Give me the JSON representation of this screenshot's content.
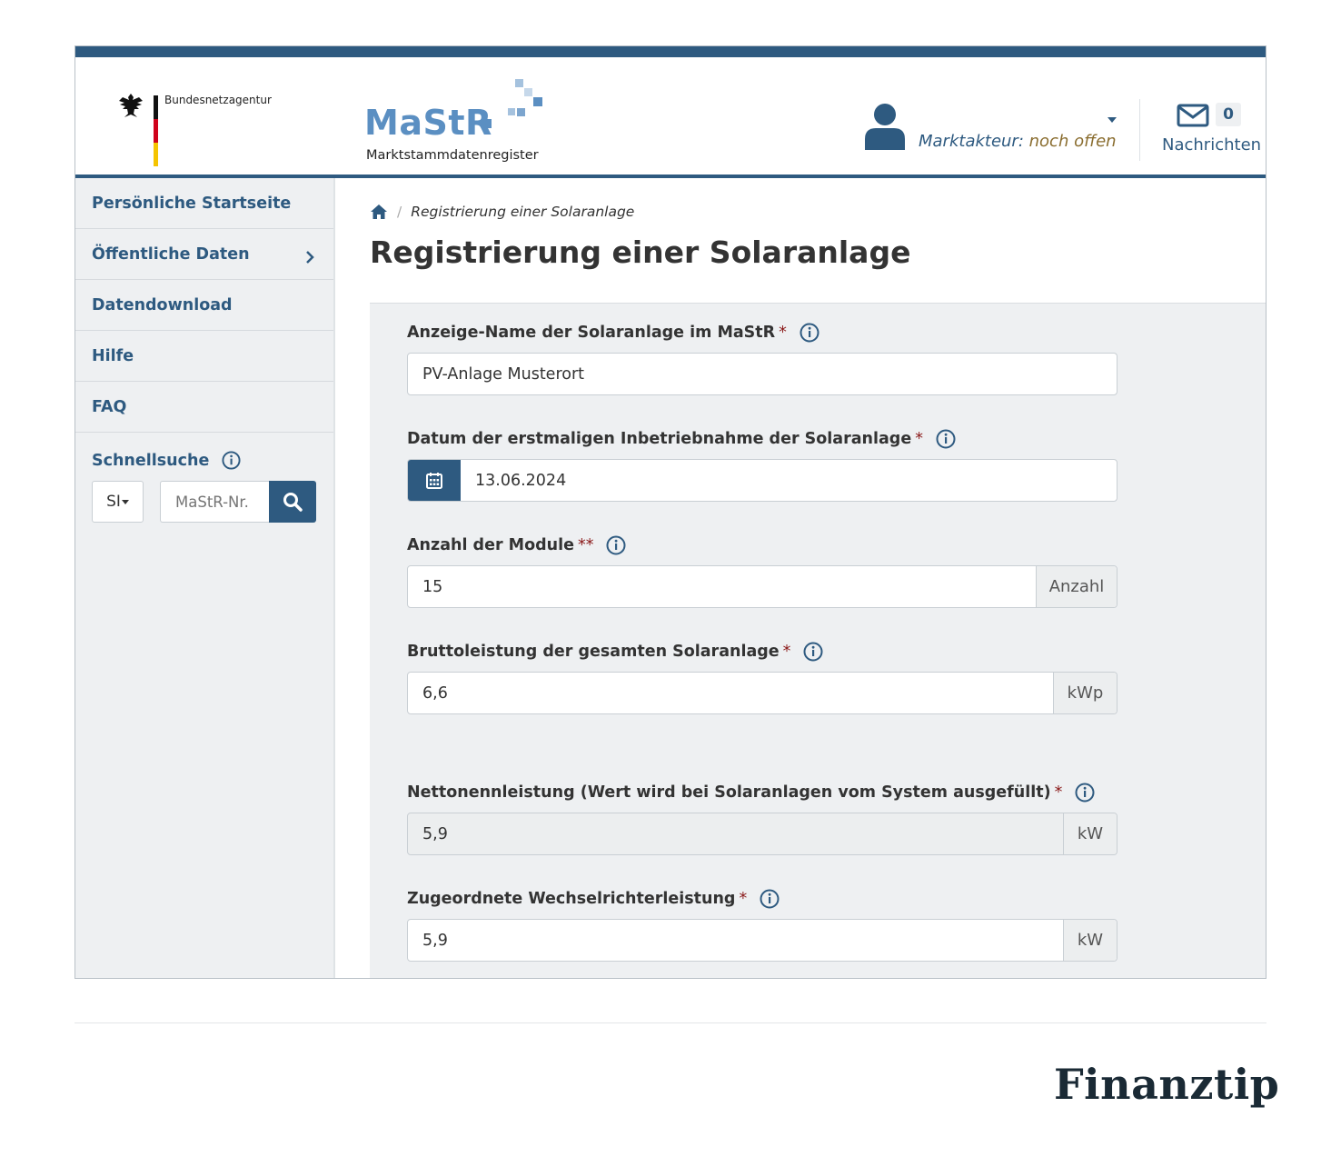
{
  "header": {
    "org_name": "Bundesnetzagentur",
    "logo_word": "MaStR",
    "logo_subtitle": "Marktstammdatenregister",
    "user_label_key": "Marktakteur:",
    "user_label_value": "noch offen",
    "messages_count": "0",
    "messages_label": "Nachrichten"
  },
  "sidebar": {
    "items": [
      {
        "label": "Persönliche Startseite"
      },
      {
        "label": "Öffentliche Daten"
      },
      {
        "label": "Datendownload"
      },
      {
        "label": "Hilfe"
      },
      {
        "label": "FAQ"
      }
    ],
    "quick_search": {
      "title": "Schnellsuche",
      "select_value": "SI",
      "placeholder": "MaStR-Nr."
    }
  },
  "breadcrumb": {
    "current": "Registrierung einer Solaranlage"
  },
  "page_title": "Registrierung einer Solaranlage",
  "form": {
    "fields": [
      {
        "label": "Anzeige-Name der Solaranlage im MaStR",
        "required": "*",
        "value": "PV-Anlage Musterort"
      },
      {
        "label": "Datum der erstmaligen Inbetriebnahme der Solaranlage",
        "required": "*",
        "value": "13.06.2024"
      },
      {
        "label": "Anzahl der Module",
        "required": "**",
        "value": "15",
        "unit": "Anzahl"
      },
      {
        "label": "Bruttoleistung der gesamten Solaranlage",
        "required": "*",
        "value": "6,6",
        "unit": "kWp"
      },
      {
        "label": "Nettonennleistung (Wert wird bei Solaranlagen vom System ausgefüllt)",
        "required": "*",
        "value": "5,9",
        "unit": "kW"
      },
      {
        "label": "Zugeordnete Wechselrichterleistung",
        "required": "*",
        "value": "5,9",
        "unit": "kW"
      }
    ]
  },
  "footer": {
    "brand": "Finanztip"
  },
  "colors": {
    "primary": "#2e5a80",
    "logo_blue": "#5b8fc2",
    "required_star": "#8b1a1a",
    "user_value": "#8a6d2f"
  }
}
